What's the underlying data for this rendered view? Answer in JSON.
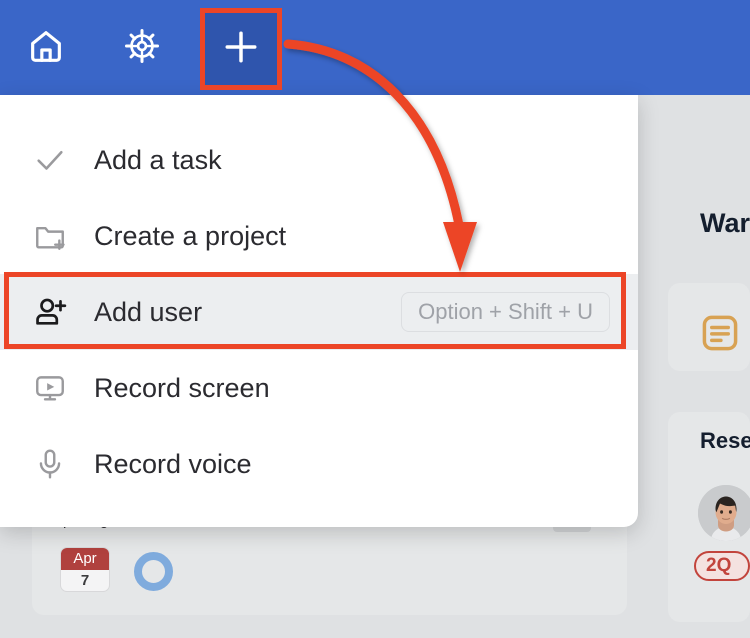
{
  "topbar": {
    "background_color": "#3a66c8",
    "buttons": [
      {
        "name": "home",
        "icon": "home-icon",
        "label": "Home"
      },
      {
        "name": "settings",
        "icon": "gear-icon",
        "label": "Settings"
      },
      {
        "name": "add",
        "icon": "plus-icon",
        "label": "Add"
      }
    ],
    "add_button": {
      "label": "+",
      "background_color": "#2f55ad",
      "highlighted": true
    }
  },
  "dropdown": {
    "items": [
      {
        "label": "Add a task",
        "icon": "check-icon",
        "shortcut": "",
        "selected": false
      },
      {
        "label": "Create a project",
        "icon": "folder-plus-icon",
        "shortcut": "",
        "selected": false
      },
      {
        "label": "Add user",
        "icon": "user-plus-icon",
        "shortcut": "Option + Shift + U",
        "selected": true
      },
      {
        "label": "Record screen",
        "icon": "screen-record-icon",
        "shortcut": "",
        "selected": false
      },
      {
        "label": "Record voice",
        "icon": "microphone-icon",
        "shortcut": "",
        "selected": false
      }
    ]
  },
  "annotation": {
    "color": "#ec4527",
    "target_label": "Add user",
    "source_label": "Add"
  },
  "background": {
    "card": {
      "date_badge": {
        "month": "Apr",
        "day": "7"
      },
      "ghost_text_a": "p",
      "ghost_text_b": "g"
    }
  },
  "right_panel": {
    "title": "Warr",
    "card_a": {
      "icon": "document-icon",
      "icon_color": "#d8a253"
    },
    "card_b": {
      "title": "Rese",
      "avatar": "user-avatar",
      "badge": "2Q",
      "badge_color": "#c2443c"
    }
  }
}
